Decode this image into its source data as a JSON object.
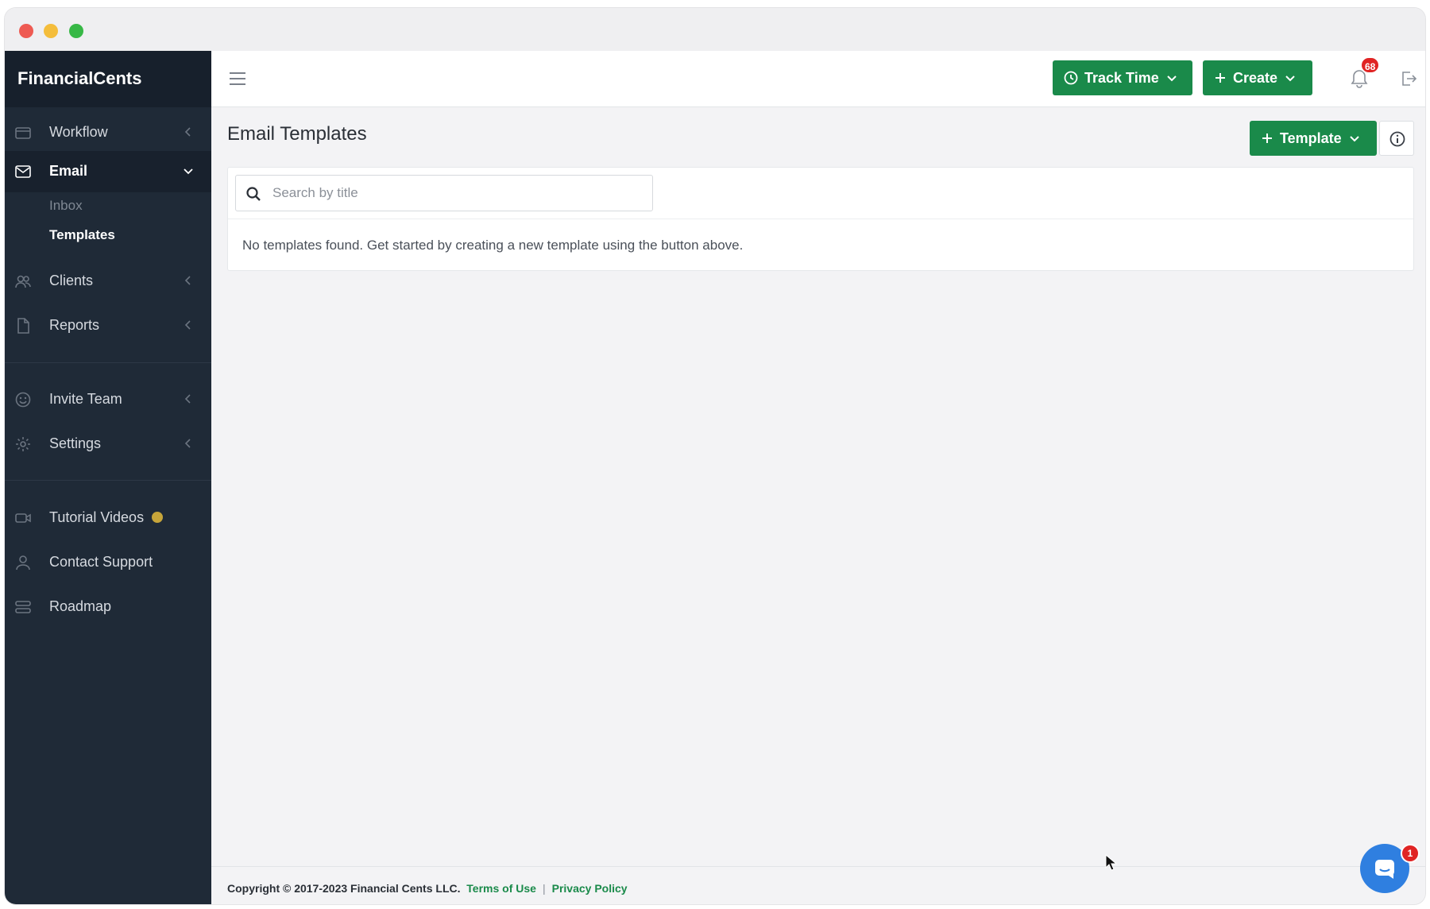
{
  "sidebar": {
    "brand": "FinancialCents",
    "items": [
      {
        "label": "Workflow",
        "icon": "folder-icon"
      },
      {
        "label": "Email",
        "icon": "envelope-icon"
      },
      {
        "label": "Clients",
        "icon": "users-icon"
      },
      {
        "label": "Reports",
        "icon": "file-icon"
      },
      {
        "label": "Invite Team",
        "icon": "smile-icon"
      },
      {
        "label": "Settings",
        "icon": "gear-icon"
      },
      {
        "label": "Tutorial Videos",
        "icon": "video-icon"
      },
      {
        "label": "Contact Support",
        "icon": "user-icon"
      },
      {
        "label": "Roadmap",
        "icon": "layers-icon"
      }
    ],
    "email_sub": {
      "inbox": "Inbox",
      "templates": "Templates"
    }
  },
  "topbar": {
    "track_time": "Track Time",
    "create": "Create",
    "notification_count": "68"
  },
  "main": {
    "title": "Email Templates",
    "template_button": "Template",
    "search_placeholder": "Search by title",
    "empty_message": "No templates found. Get started by creating a new template using the button above."
  },
  "footer": {
    "copyright": "Copyright © 2017-2023 Financial Cents LLC.",
    "terms": "Terms of Use",
    "separator": "|",
    "privacy": "Privacy Policy"
  },
  "chat": {
    "badge": "1"
  },
  "colors": {
    "sidebar": "#1f2a37",
    "accent_green": "#1a8a4a",
    "badge_red": "#e02424",
    "chat_blue": "#2f7fe0"
  }
}
